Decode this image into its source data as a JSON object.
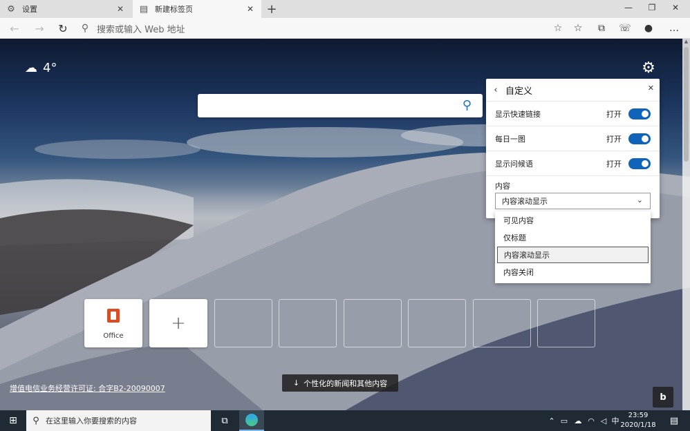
{
  "tabs": [
    {
      "label": "设置",
      "icon": "gear-icon"
    },
    {
      "label": "新建标签页",
      "icon": "newtab-page-icon"
    }
  ],
  "address": {
    "placeholder": "搜索或输入 Web 地址"
  },
  "weather": {
    "temp": "4°",
    "icon": "cloud-icon"
  },
  "panel": {
    "title": "自定义",
    "rows": [
      {
        "label": "显示快速链接",
        "state": "打开"
      },
      {
        "label": "每日一图",
        "state": "打开"
      },
      {
        "label": "显示问候语",
        "state": "打开"
      }
    ],
    "content_label": "内容",
    "content_selected": "内容滚动显示",
    "options": [
      "可见内容",
      "仅标题",
      "内容滚动显示",
      "内容关闭"
    ]
  },
  "quicklinks": {
    "office": "Office",
    "add": "+"
  },
  "license_text": "增值电信业务经营许可证: 合字B2-20090007",
  "news_button": "个性化的新闻和其他内容",
  "bing": "b",
  "taskbar": {
    "search_placeholder": "在这里输入你要搜索的内容",
    "ime": "中",
    "time": "23:59",
    "date": "2020/1/18"
  },
  "colors": {
    "accent": "#0f63b8",
    "taskbar": "#1f2a35"
  }
}
